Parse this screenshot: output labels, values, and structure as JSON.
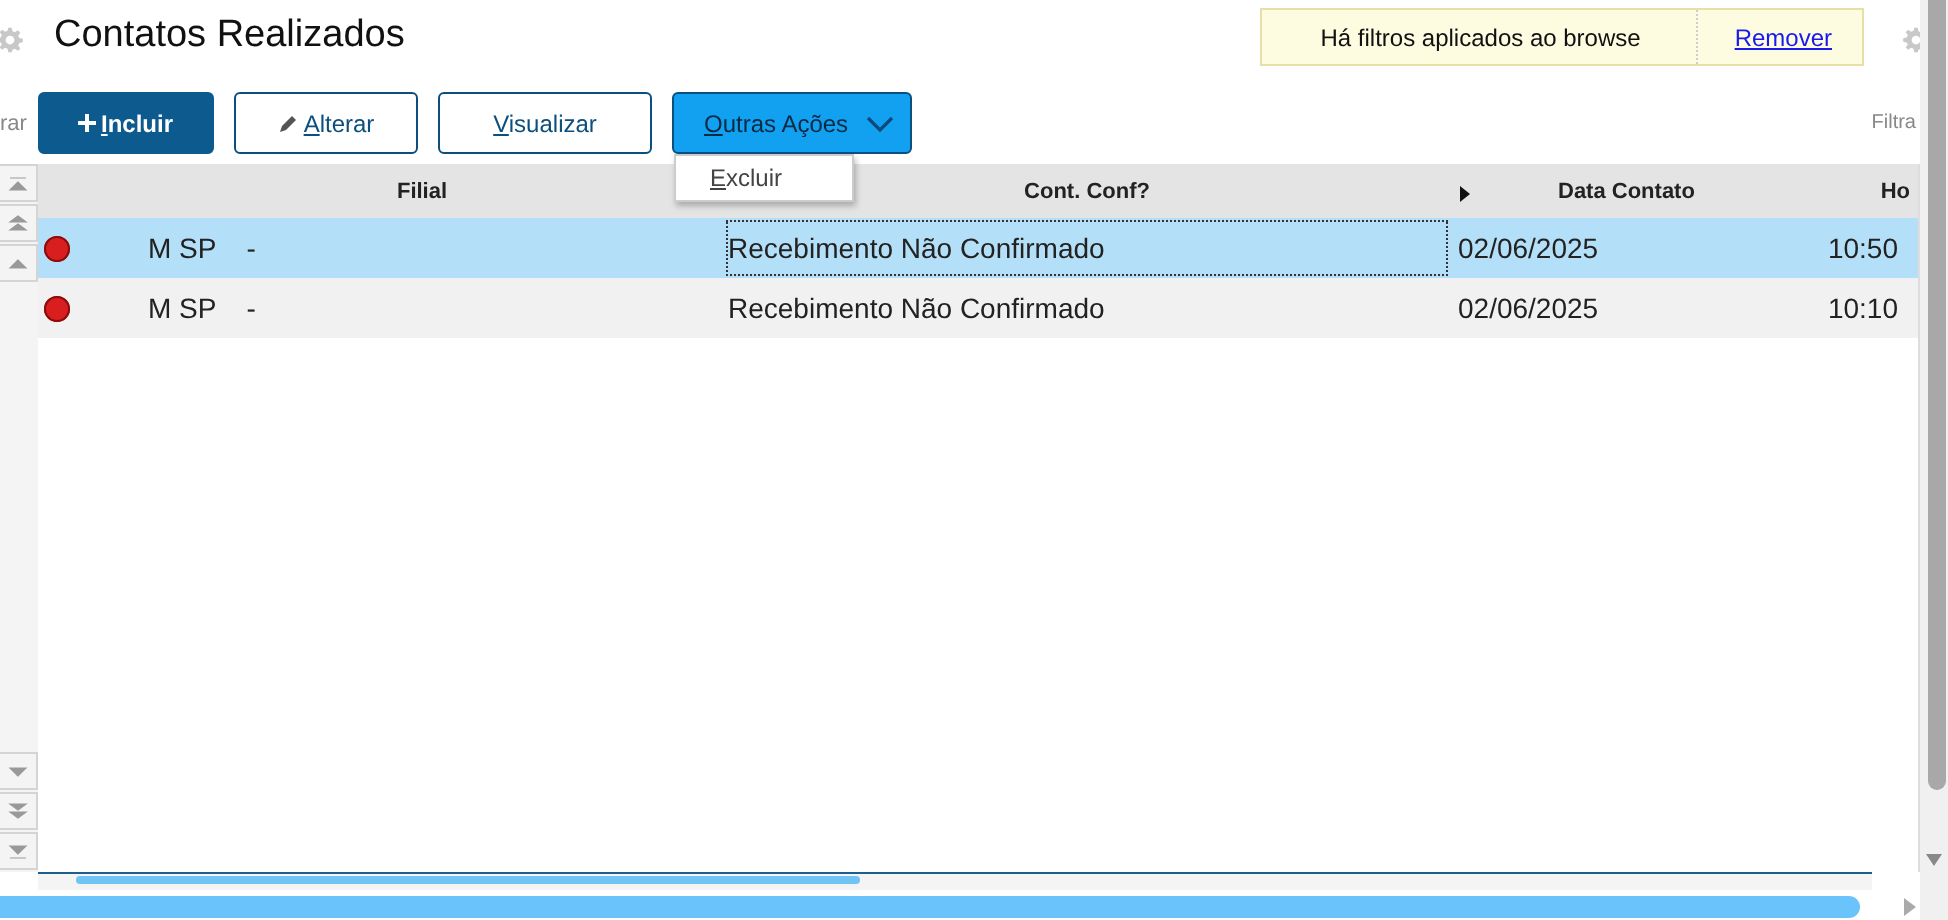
{
  "title": "Contatos Realizados",
  "filter_notice": {
    "text": "Há filtros aplicados ao browse",
    "link": "Remover"
  },
  "toolbar": {
    "left_label": "rar",
    "right_label": "Filtra",
    "buttons": [
      {
        "label": "Incluir",
        "kind": "primary"
      },
      {
        "label": "Alterar",
        "kind": "edit"
      },
      {
        "label": "Visualizar",
        "kind": "outline"
      },
      {
        "label": "Outras Ações",
        "kind": "dropdown",
        "expanded": true
      }
    ],
    "menu": [
      "Excluir"
    ]
  },
  "table": {
    "columns": [
      "Filial",
      "Cont. Conf?",
      "Data Contato",
      "Ho"
    ],
    "rows": [
      {
        "selected": true,
        "focused": true,
        "color": "#d81e1e",
        "cells": [
          [
            "M SP",
            "-"
          ],
          [
            "Recebimento Não Confirmado"
          ],
          [
            "02/06/2025"
          ],
          [
            "10:50"
          ]
        ]
      },
      {
        "selected": false,
        "focused": false,
        "color": "#d81e1e",
        "cells": [
          [
            "M SP",
            "-"
          ],
          [
            "Recebimento Não Confirmado"
          ],
          [
            "02/06/2025"
          ],
          [
            "10:10"
          ]
        ]
      }
    ]
  }
}
